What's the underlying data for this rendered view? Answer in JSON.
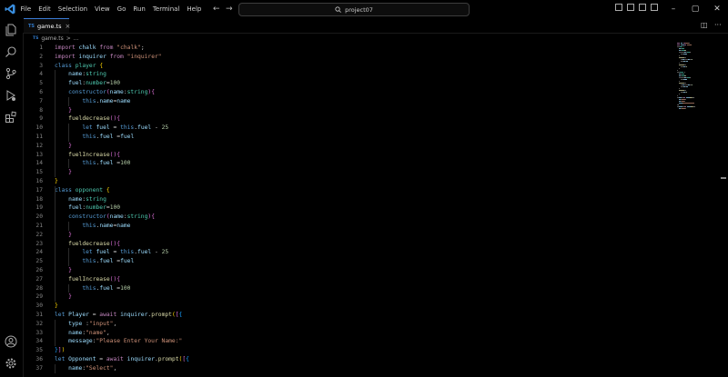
{
  "menu": [
    "File",
    "Edit",
    "Selection",
    "View",
    "Go",
    "Run",
    "Terminal",
    "Help"
  ],
  "search": {
    "text": "project07"
  },
  "tab": {
    "label": "game.ts",
    "lang": "TS",
    "close": "×"
  },
  "breadcrumb": {
    "file": "game.ts",
    "sep": ">",
    "more": "..."
  },
  "winctl": {
    "min": "–",
    "max": "▢",
    "close": "✕"
  },
  "colors": {
    "accent": "#3a7bd5",
    "ts": "#3178c6",
    "keyword": "#c586c0",
    "string": "#ce9178",
    "number": "#b5cea8",
    "ident": "#9cdcfe",
    "type": "#4ec9b0",
    "func": "#dcdcaa"
  },
  "code_lines": [
    [
      [
        "kw",
        "import"
      ],
      [
        "plain",
        " "
      ],
      [
        "id",
        "chalk"
      ],
      [
        "plain",
        " "
      ],
      [
        "kw",
        "from"
      ],
      [
        "plain",
        " "
      ],
      [
        "str",
        "\"chalk\""
      ],
      [
        "plain",
        ";"
      ]
    ],
    [
      [
        "kw",
        "import"
      ],
      [
        "plain",
        " "
      ],
      [
        "id",
        "inquirer"
      ],
      [
        "plain",
        " "
      ],
      [
        "kw",
        "from"
      ],
      [
        "plain",
        " "
      ],
      [
        "str",
        "\"inquirer\""
      ]
    ],
    [
      [
        "kwb",
        "class"
      ],
      [
        "plain",
        " "
      ],
      [
        "ty",
        "player"
      ],
      [
        "plain",
        " "
      ],
      [
        "br1",
        "{"
      ]
    ],
    [
      [
        "plain",
        "    "
      ],
      [
        "id",
        "name"
      ],
      [
        "plain",
        ":"
      ],
      [
        "ty",
        "string"
      ]
    ],
    [
      [
        "plain",
        "    "
      ],
      [
        "id",
        "fuel"
      ],
      [
        "plain",
        ":"
      ],
      [
        "ty",
        "number"
      ],
      [
        "plain",
        "="
      ],
      [
        "num",
        "100"
      ]
    ],
    [
      [
        "plain",
        "    "
      ],
      [
        "kwb",
        "constructor"
      ],
      [
        "br2",
        "("
      ],
      [
        "id",
        "name"
      ],
      [
        "plain",
        ":"
      ],
      [
        "ty",
        "string"
      ],
      [
        "br2",
        ")"
      ],
      [
        "br2",
        "{"
      ]
    ],
    [
      [
        "plain",
        "        "
      ],
      [
        "kwb",
        "this"
      ],
      [
        "plain",
        "."
      ],
      [
        "id",
        "name"
      ],
      [
        "plain",
        "="
      ],
      [
        "id",
        "name"
      ]
    ],
    [
      [
        "plain",
        "    "
      ],
      [
        "br2",
        "}"
      ]
    ],
    [
      [
        "plain",
        "    "
      ],
      [
        "fn",
        "fueldecrease"
      ],
      [
        "br2",
        "()"
      ],
      [
        "br2",
        "{"
      ]
    ],
    [
      [
        "plain",
        "        "
      ],
      [
        "kwb",
        "let"
      ],
      [
        "plain",
        " "
      ],
      [
        "id",
        "fuel"
      ],
      [
        "plain",
        " = "
      ],
      [
        "kwb",
        "this"
      ],
      [
        "plain",
        "."
      ],
      [
        "id",
        "fuel"
      ],
      [
        "plain",
        " - "
      ],
      [
        "num",
        "25"
      ]
    ],
    [
      [
        "plain",
        "        "
      ],
      [
        "kwb",
        "this"
      ],
      [
        "plain",
        "."
      ],
      [
        "id",
        "fuel"
      ],
      [
        "plain",
        " ="
      ],
      [
        "id",
        "fuel"
      ]
    ],
    [
      [
        "plain",
        "    "
      ],
      [
        "br2",
        "}"
      ]
    ],
    [
      [
        "plain",
        "    "
      ],
      [
        "fn",
        "fuelIncrease"
      ],
      [
        "br2",
        "()"
      ],
      [
        "br2",
        "{"
      ]
    ],
    [
      [
        "plain",
        "        "
      ],
      [
        "kwb",
        "this"
      ],
      [
        "plain",
        "."
      ],
      [
        "id",
        "fuel"
      ],
      [
        "plain",
        " ="
      ],
      [
        "num",
        "100"
      ]
    ],
    [
      [
        "plain",
        "    "
      ],
      [
        "br2",
        "}"
      ]
    ],
    [
      [
        "br1",
        "}"
      ]
    ],
    [
      [
        "kwb",
        "class"
      ],
      [
        "plain",
        " "
      ],
      [
        "ty",
        "opponent"
      ],
      [
        "plain",
        " "
      ],
      [
        "br1",
        "{"
      ]
    ],
    [
      [
        "plain",
        "    "
      ],
      [
        "id",
        "name"
      ],
      [
        "plain",
        ":"
      ],
      [
        "ty",
        "string"
      ]
    ],
    [
      [
        "plain",
        "    "
      ],
      [
        "id",
        "fuel"
      ],
      [
        "plain",
        ":"
      ],
      [
        "ty",
        "number"
      ],
      [
        "plain",
        "="
      ],
      [
        "num",
        "100"
      ]
    ],
    [
      [
        "plain",
        "    "
      ],
      [
        "kwb",
        "constructor"
      ],
      [
        "br2",
        "("
      ],
      [
        "id",
        "name"
      ],
      [
        "plain",
        ":"
      ],
      [
        "ty",
        "string"
      ],
      [
        "br2",
        ")"
      ],
      [
        "br2",
        "{"
      ]
    ],
    [
      [
        "plain",
        "        "
      ],
      [
        "kwb",
        "this"
      ],
      [
        "plain",
        "."
      ],
      [
        "id",
        "name"
      ],
      [
        "plain",
        "="
      ],
      [
        "id",
        "name"
      ]
    ],
    [
      [
        "plain",
        "    "
      ],
      [
        "br2",
        "}"
      ]
    ],
    [
      [
        "plain",
        "    "
      ],
      [
        "fn",
        "fueldecrease"
      ],
      [
        "br2",
        "()"
      ],
      [
        "br2",
        "{"
      ]
    ],
    [
      [
        "plain",
        "        "
      ],
      [
        "kwb",
        "let"
      ],
      [
        "plain",
        " "
      ],
      [
        "id",
        "fuel"
      ],
      [
        "plain",
        " = "
      ],
      [
        "kwb",
        "this"
      ],
      [
        "plain",
        "."
      ],
      [
        "id",
        "fuel"
      ],
      [
        "plain",
        " - "
      ],
      [
        "num",
        "25"
      ]
    ],
    [
      [
        "plain",
        "        "
      ],
      [
        "kwb",
        "this"
      ],
      [
        "plain",
        "."
      ],
      [
        "id",
        "fuel"
      ],
      [
        "plain",
        " ="
      ],
      [
        "id",
        "fuel"
      ]
    ],
    [
      [
        "plain",
        "    "
      ],
      [
        "br2",
        "}"
      ]
    ],
    [
      [
        "plain",
        "    "
      ],
      [
        "fn",
        "fuelIncrease"
      ],
      [
        "br2",
        "()"
      ],
      [
        "br2",
        "{"
      ]
    ],
    [
      [
        "plain",
        "        "
      ],
      [
        "kwb",
        "this"
      ],
      [
        "plain",
        "."
      ],
      [
        "id",
        "fuel"
      ],
      [
        "plain",
        " ="
      ],
      [
        "num",
        "100"
      ]
    ],
    [
      [
        "plain",
        "    "
      ],
      [
        "br2",
        "}"
      ]
    ],
    [
      [
        "br1",
        "}"
      ]
    ],
    [
      [
        "kwb",
        "let"
      ],
      [
        "plain",
        " "
      ],
      [
        "id",
        "Player"
      ],
      [
        "plain",
        " = "
      ],
      [
        "kw",
        "await"
      ],
      [
        "plain",
        " "
      ],
      [
        "id",
        "inquirer"
      ],
      [
        "plain",
        "."
      ],
      [
        "fn",
        "prompt"
      ],
      [
        "br1",
        "("
      ],
      [
        "br2",
        "["
      ],
      [
        "br3",
        "{"
      ]
    ],
    [
      [
        "plain",
        "    "
      ],
      [
        "id",
        "type"
      ],
      [
        "plain",
        " :"
      ],
      [
        "str",
        "\"input\""
      ],
      [
        "plain",
        ","
      ]
    ],
    [
      [
        "plain",
        "    "
      ],
      [
        "id",
        "name"
      ],
      [
        "plain",
        ":"
      ],
      [
        "str",
        "\"name\""
      ],
      [
        "plain",
        ","
      ]
    ],
    [
      [
        "plain",
        "    "
      ],
      [
        "id",
        "message"
      ],
      [
        "plain",
        ":"
      ],
      [
        "str",
        "\"Please Enter Your Name:\""
      ]
    ],
    [
      [
        "br3",
        "}"
      ],
      [
        "br2",
        "]"
      ],
      [
        "br1",
        ")"
      ]
    ],
    [
      [
        "kwb",
        "let"
      ],
      [
        "plain",
        " "
      ],
      [
        "id",
        "Opponent"
      ],
      [
        "plain",
        " = "
      ],
      [
        "kw",
        "await"
      ],
      [
        "plain",
        " "
      ],
      [
        "id",
        "inquirer"
      ],
      [
        "plain",
        "."
      ],
      [
        "fn",
        "prompt"
      ],
      [
        "br1",
        "("
      ],
      [
        "br2",
        "["
      ],
      [
        "br3",
        "{"
      ]
    ],
    [
      [
        "plain",
        "    "
      ],
      [
        "id",
        "name"
      ],
      [
        "plain",
        ":"
      ],
      [
        "str",
        "\"Select\""
      ],
      [
        "plain",
        ","
      ]
    ]
  ]
}
